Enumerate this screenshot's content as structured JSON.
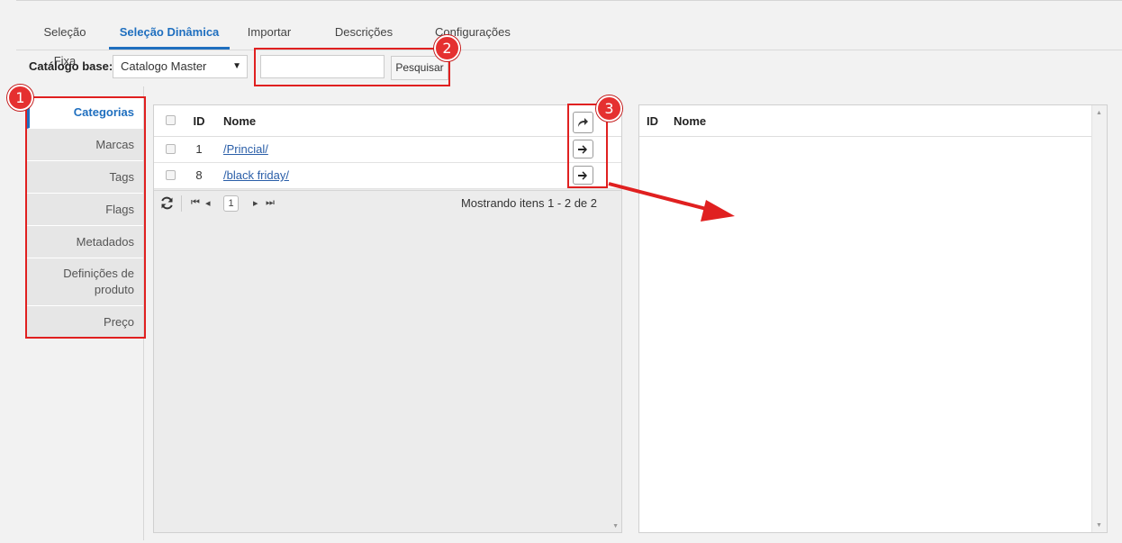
{
  "tabs": [
    {
      "label": "Seleção Fixa",
      "active": false
    },
    {
      "label": "Seleção Dinâmica",
      "active": true
    },
    {
      "label": "Importar",
      "active": false
    },
    {
      "label": "Descrições (SEO)",
      "active": false
    },
    {
      "label": "Configurações",
      "active": false
    }
  ],
  "filter": {
    "catalog_label": "Catálogo base:",
    "catalog_value": "Catalogo Master",
    "search_value": "",
    "search_button": "Pesquisar"
  },
  "side_nav": [
    {
      "label": "Categorias",
      "active": true
    },
    {
      "label": "Marcas",
      "active": false
    },
    {
      "label": "Tags",
      "active": false
    },
    {
      "label": "Flags",
      "active": false
    },
    {
      "label": "Metadados",
      "active": false
    },
    {
      "label": "Definições de produto",
      "active": false
    },
    {
      "label": "Preço",
      "active": false
    }
  ],
  "left_grid": {
    "headers": {
      "id": "ID",
      "name": "Nome"
    },
    "rows": [
      {
        "id": "1",
        "name": "/Princial/"
      },
      {
        "id": "8",
        "name": "/black friday/"
      }
    ],
    "pager": {
      "page": "1",
      "showing": "Mostrando itens 1 - 2 de 2"
    }
  },
  "right_grid": {
    "headers": {
      "id": "ID",
      "name": "Nome"
    }
  },
  "annotations": [
    "1",
    "2",
    "3"
  ],
  "colors": {
    "accent": "#1f6fbf",
    "annotation": "#e02020",
    "link": "#2a5ea8"
  }
}
